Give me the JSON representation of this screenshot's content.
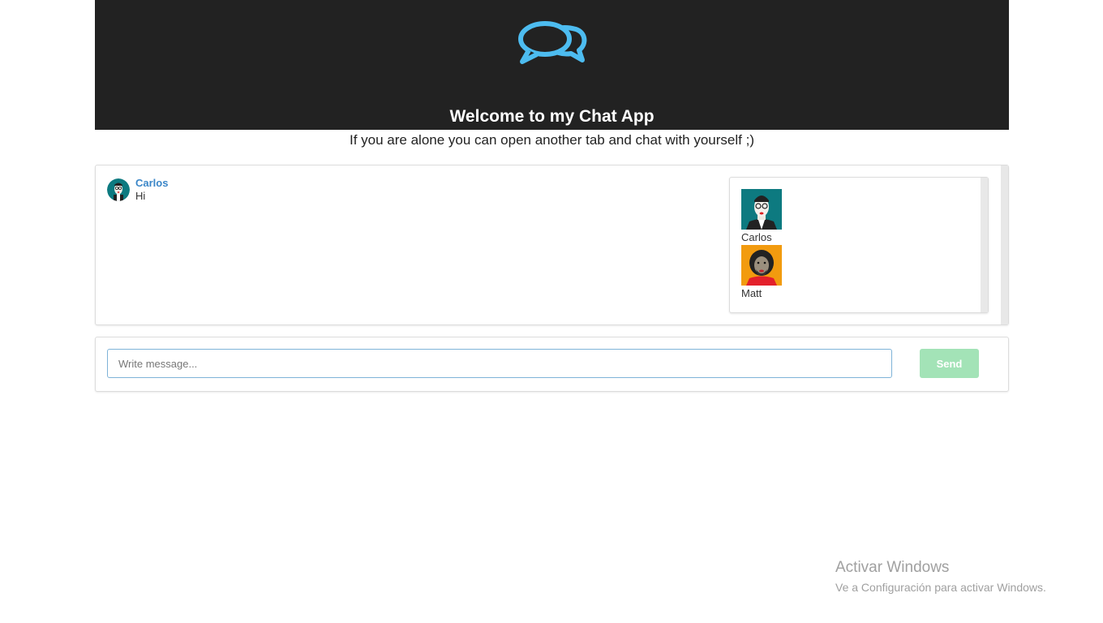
{
  "header": {
    "logo_icon": "chat-bubbles-icon",
    "title": "Welcome to my Chat App",
    "subtitle": "If you are alone you can open another tab and chat with yourself ;)",
    "colors": {
      "background": "#222222",
      "logo": "#4dbcf0"
    }
  },
  "messages": [
    {
      "author": "Carlos",
      "text": "Hi",
      "avatar_icon": "carlos-avatar-icon"
    }
  ],
  "users": [
    {
      "name": "Carlos",
      "avatar_icon": "carlos-avatar-icon"
    },
    {
      "name": "Matt",
      "avatar_icon": "matt-avatar-icon"
    }
  ],
  "compose": {
    "placeholder": "Write message...",
    "value": "",
    "send_label": "Send",
    "send_color": "#a3e3b7"
  },
  "watermark": {
    "title": "Activar Windows",
    "subtitle": "Ve a Configuración para activar Windows."
  }
}
